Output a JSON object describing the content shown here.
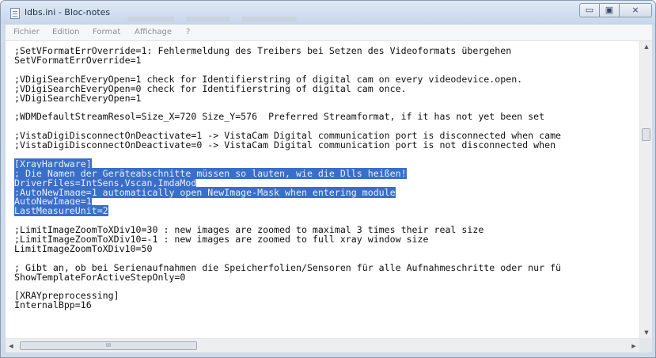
{
  "window": {
    "title": "ldbs.ini - Bloc-notes"
  },
  "window_buttons": {
    "minimize": "▭",
    "maximize": "▣",
    "close": "⨯"
  },
  "menu": {
    "items": [
      "Fichier",
      "Edition",
      "Format",
      "Affichage",
      "?"
    ]
  },
  "editor": {
    "lines": [
      ";SetVFormatErrOverride=1: Fehlermeldung des Treibers bei Setzen des Videoformats übergehen",
      "SetVFormatErrOverride=1",
      "",
      ";VDigiSearchEveryOpen=1 check for Identifierstring of digital cam on every videodevice.open.",
      ";VDigiSearchEveryOpen=0 check for Identifierstring of digital cam once.",
      ";VDigiSearchEveryOpen=1",
      "",
      ";WDMDefaultStreamResol=Size_X=720 Size_Y=576  Preferred Streamformat, if it has not yet been set",
      "",
      ";VistaDigiDisconnectOnDeactivate=1 -> VistaCam Digital communication port is disconnected when came",
      ";VistaDigiDisconnectOnDeactivate=0 -> VistaCam Digital communication port is not disconnected when",
      "",
      "[XrayHardware]",
      "; Die Namen der Geräteabschnitte müssen so lauten, wie die Dlls heißen!",
      "DriverFiles=IntSens,Vscan,ImdaMod",
      ";AutoNewImage=1 automatically open NewImage-Mask when entering module",
      "AutoNewImage=1",
      "LastMeasureUnit=2",
      "",
      ";LimitImageZoomToXDiv10=30 : new images are zoomed to maximal 3 times their real size",
      ";LimitImageZoomToXDiv10=-1 : new images are zoomed to full xray window size",
      "LimitImageZoomToXDiv10=50",
      "",
      "; Gibt an, ob bei Serienaufnahmen die Speicherfolien/Sensoren für alle Aufnahmeschritte oder nur fü",
      "ShowTemplateForActiveStepOnly=0",
      "",
      "[XRAYpreprocessing]",
      "InternalBpp=16"
    ],
    "selection": {
      "first_line": 12,
      "last_line": 17
    }
  },
  "scrollbar": {
    "up": "▲",
    "down": "▼",
    "left": "◀",
    "right": "▶",
    "grip": "III"
  },
  "colors": {
    "selection": "#3a6fc9",
    "menu_text": "#8b8f95"
  }
}
